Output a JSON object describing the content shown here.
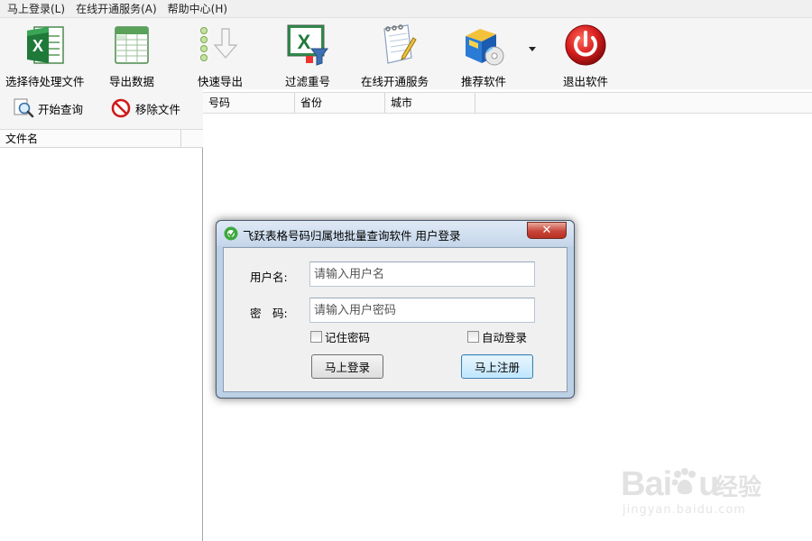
{
  "menu": {
    "items": [
      {
        "label": "马上登录(L)"
      },
      {
        "label": "在线开通服务(A)"
      },
      {
        "label": "帮助中心(H)"
      }
    ]
  },
  "toolbar": {
    "buttons": [
      {
        "label": "选择待处理文件",
        "icon": "excel-file-icon"
      },
      {
        "label": "导出数据",
        "icon": "spreadsheet-icon"
      },
      {
        "label": "快速导出",
        "icon": "download-arrow-icon"
      },
      {
        "label": "过滤重号",
        "icon": "excel-filter-icon"
      },
      {
        "label": "在线开通服务",
        "icon": "notepad-pencil-icon"
      },
      {
        "label": "推荐软件",
        "icon": "software-box-icon"
      },
      {
        "label": "退出软件",
        "icon": "power-icon"
      }
    ],
    "dropdown_icon": "dropdown-arrow-icon"
  },
  "left_panel": {
    "start_query_label": "开始查询",
    "remove_file_label": "移除文件",
    "column_header": "文件名"
  },
  "grid": {
    "columns": [
      "号码",
      "省份",
      "城市"
    ]
  },
  "dialog": {
    "title": "飞跃表格号码归属地批量查询软件 用户登录",
    "close_label": "✕",
    "username_label": "用户名:",
    "username_placeholder": "请输入用户名",
    "password_label": "密　码:",
    "password_placeholder": "请输入用户密码",
    "remember_label": "记住密码",
    "autologin_label": "自动登录",
    "login_button": "马上登录",
    "register_button": "马上注册"
  },
  "watermark": {
    "logo": "Bai",
    "logo_end": "u",
    "jingyan": "经验",
    "url": "jingyan.baidu.com"
  },
  "colors": {
    "dialog_frame": "#bcd0e6",
    "close_button": "#c7453a",
    "power_red": "#d81e1e",
    "excel_green": "#1f7a3a"
  }
}
